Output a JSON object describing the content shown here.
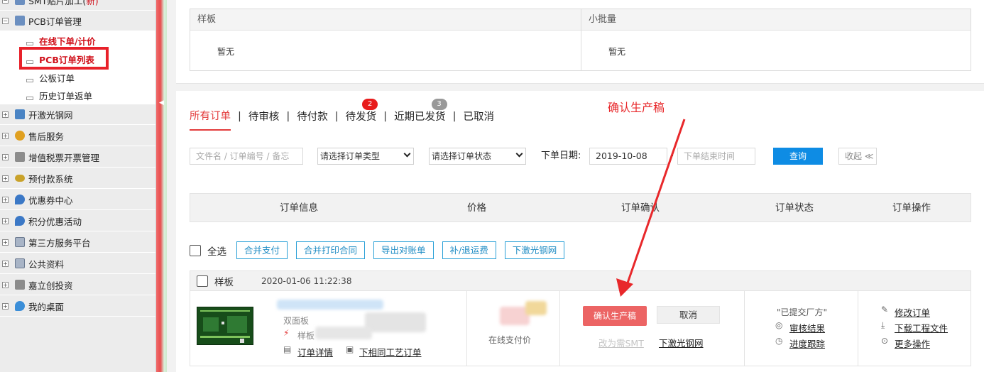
{
  "sidebar": {
    "top_item": {
      "label": "SMT贴片加工(",
      "suffix": "新)"
    },
    "pcb_group": "PCB订单管理",
    "pcb_sub": [
      {
        "label": "在线下单/计价"
      },
      {
        "label": "PCB订单列表"
      },
      {
        "label": "公板订单"
      },
      {
        "label": "历史订单返单"
      }
    ],
    "items": [
      {
        "label": "开激光钢网",
        "icon_color": "#4a84c4"
      },
      {
        "label": "售后服务",
        "icon_color": "#e0a020"
      },
      {
        "label": "增值税票开票管理",
        "icon_color": "#7a7a7a"
      },
      {
        "label": "预付款系统",
        "icon_color": "#c9a22a"
      },
      {
        "label": "优惠券中心",
        "icon_color": "#3b78c6"
      },
      {
        "label": "积分优惠活动",
        "icon_color": "#3b78c6"
      },
      {
        "label": "第三方服务平台",
        "icon_color": "#8090a8"
      },
      {
        "label": "公共资料",
        "icon_color": "#8090a8"
      },
      {
        "label": "嘉立创投资",
        "icon_color": "#7a7a7a"
      },
      {
        "label": "我的桌面",
        "icon_color": "#3b8ed8"
      }
    ]
  },
  "top_panel": {
    "sample": {
      "title": "样板",
      "value": "暂无"
    },
    "small_batch": {
      "title": "小批量",
      "value": "暂无"
    }
  },
  "tabs": [
    {
      "label": "所有订单",
      "active": true
    },
    {
      "label": "待审核"
    },
    {
      "label": "待付款"
    },
    {
      "label": "待发货",
      "badge": "2"
    },
    {
      "label": "近期已发货",
      "badge": "3"
    },
    {
      "label": "已取消"
    }
  ],
  "filters": {
    "search_placeholder": "文件名 / 订单编号 / 备忘",
    "order_type": "请选择订单类型",
    "order_status": "请选择订单状态",
    "date_label": "下单日期:",
    "start_date": "2019-10-08",
    "dash": "-",
    "end_placeholder": "下单结束时间",
    "query": "查询",
    "collapse": "收起 ≪"
  },
  "table_headers": [
    "订单信息",
    "价格",
    "订单确认",
    "订单状态",
    "订单操作"
  ],
  "actions": {
    "select_all": "全选",
    "buttons": [
      "合并支付",
      "合并打印合同",
      "导出对账单",
      "补/退运费",
      "下激光钢网"
    ]
  },
  "order": {
    "type": "样板",
    "time": "2020-01-06 11:22:38",
    "board_type": "双面板",
    "tag": "样板",
    "detail_link": "订单详情",
    "same_process_link": "下相同工艺订单",
    "payment": "在线支付价",
    "confirm_btn": "确认生产稿",
    "cancel_btn": "取消",
    "to_smt": "改为需SMT",
    "stencil_link": "下激光钢网",
    "status": "\"已提交厂方\"",
    "review_link": "审核结果",
    "progress_link": "进度跟踪",
    "ops": [
      "修改订单",
      "下载工程文件",
      "更多操作"
    ]
  },
  "annotation": "确认生产稿",
  "colors": {
    "accent_red": "#e33b3b",
    "link_blue": "#1f8cc4",
    "query_blue": "#0e8ce4",
    "confirm_red": "#ec6464"
  }
}
